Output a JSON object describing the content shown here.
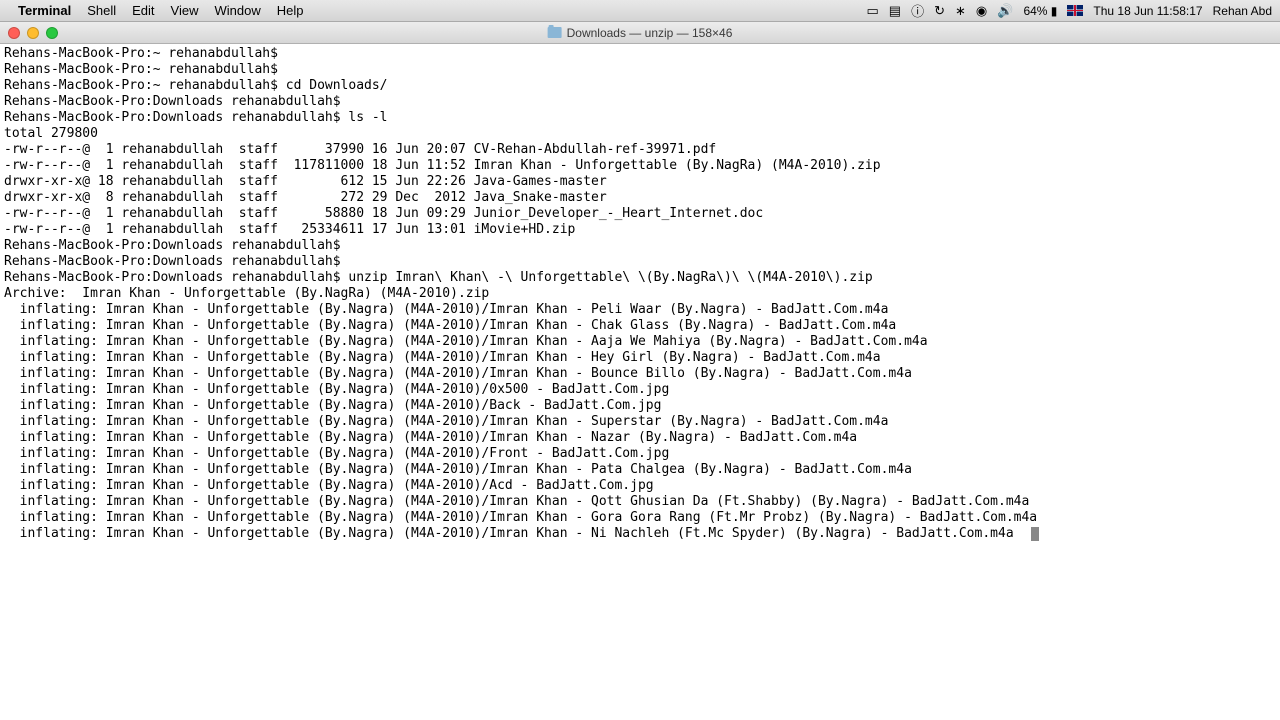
{
  "menubar": {
    "app": "Terminal",
    "items": [
      "Shell",
      "Edit",
      "View",
      "Window",
      "Help"
    ],
    "battery": "64%",
    "clock": "Thu 18 Jun  11:58:17",
    "user": "Rehan Abd"
  },
  "window": {
    "title": "Downloads — unzip — 158×46"
  },
  "terminal": {
    "lines": [
      "Rehans-MacBook-Pro:~ rehanabdullah$",
      "Rehans-MacBook-Pro:~ rehanabdullah$",
      "Rehans-MacBook-Pro:~ rehanabdullah$ cd Downloads/",
      "Rehans-MacBook-Pro:Downloads rehanabdullah$",
      "Rehans-MacBook-Pro:Downloads rehanabdullah$ ls -l",
      "total 279800",
      "-rw-r--r--@  1 rehanabdullah  staff      37990 16 Jun 20:07 CV-Rehan-Abdullah-ref-39971.pdf",
      "-rw-r--r--@  1 rehanabdullah  staff  117811000 18 Jun 11:52 Imran Khan - Unforgettable (By.NagRa) (M4A-2010).zip",
      "drwxr-xr-x@ 18 rehanabdullah  staff        612 15 Jun 22:26 Java-Games-master",
      "drwxr-xr-x@  8 rehanabdullah  staff        272 29 Dec  2012 Java_Snake-master",
      "-rw-r--r--@  1 rehanabdullah  staff      58880 18 Jun 09:29 Junior_Developer_-_Heart_Internet.doc",
      "-rw-r--r--@  1 rehanabdullah  staff   25334611 17 Jun 13:01 iMovie+HD.zip",
      "Rehans-MacBook-Pro:Downloads rehanabdullah$",
      "Rehans-MacBook-Pro:Downloads rehanabdullah$",
      "Rehans-MacBook-Pro:Downloads rehanabdullah$ unzip Imran\\ Khan\\ -\\ Unforgettable\\ \\(By.NagRa\\)\\ \\(M4A-2010\\).zip",
      "Archive:  Imran Khan - Unforgettable (By.NagRa) (M4A-2010).zip",
      "  inflating: Imran Khan - Unforgettable (By.Nagra) (M4A-2010)/Imran Khan - Peli Waar (By.Nagra) - BadJatt.Com.m4a  ",
      "  inflating: Imran Khan - Unforgettable (By.Nagra) (M4A-2010)/Imran Khan - Chak Glass (By.Nagra) - BadJatt.Com.m4a  ",
      "  inflating: Imran Khan - Unforgettable (By.Nagra) (M4A-2010)/Imran Khan - Aaja We Mahiya (By.Nagra) - BadJatt.Com.m4a  ",
      "  inflating: Imran Khan - Unforgettable (By.Nagra) (M4A-2010)/Imran Khan - Hey Girl (By.Nagra) - BadJatt.Com.m4a  ",
      "  inflating: Imran Khan - Unforgettable (By.Nagra) (M4A-2010)/Imran Khan - Bounce Billo (By.Nagra) - BadJatt.Com.m4a  ",
      "  inflating: Imran Khan - Unforgettable (By.Nagra) (M4A-2010)/0x500 - BadJatt.Com.jpg  ",
      "  inflating: Imran Khan - Unforgettable (By.Nagra) (M4A-2010)/Back - BadJatt.Com.jpg  ",
      "  inflating: Imran Khan - Unforgettable (By.Nagra) (M4A-2010)/Imran Khan - Superstar (By.Nagra) - BadJatt.Com.m4a  ",
      "  inflating: Imran Khan - Unforgettable (By.Nagra) (M4A-2010)/Imran Khan - Nazar (By.Nagra) - BadJatt.Com.m4a  ",
      "  inflating: Imran Khan - Unforgettable (By.Nagra) (M4A-2010)/Front - BadJatt.Com.jpg  ",
      "  inflating: Imran Khan - Unforgettable (By.Nagra) (M4A-2010)/Imran Khan - Pata Chalgea (By.Nagra) - BadJatt.Com.m4a  ",
      "  inflating: Imran Khan - Unforgettable (By.Nagra) (M4A-2010)/Acd - BadJatt.Com.jpg  ",
      "  inflating: Imran Khan - Unforgettable (By.Nagra) (M4A-2010)/Imran Khan - Qott Ghusian Da (Ft.Shabby) (By.Nagra) - BadJatt.Com.m4a  ",
      "  inflating: Imran Khan - Unforgettable (By.Nagra) (M4A-2010)/Imran Khan - Gora Gora Rang (Ft.Mr Probz) (By.Nagra) - BadJatt.Com.m4a  ",
      "  inflating: Imran Khan - Unforgettable (By.Nagra) (M4A-2010)/Imran Khan - Ni Nachleh (Ft.Mc Spyder) (By.Nagra) - BadJatt.Com.m4a  "
    ]
  }
}
